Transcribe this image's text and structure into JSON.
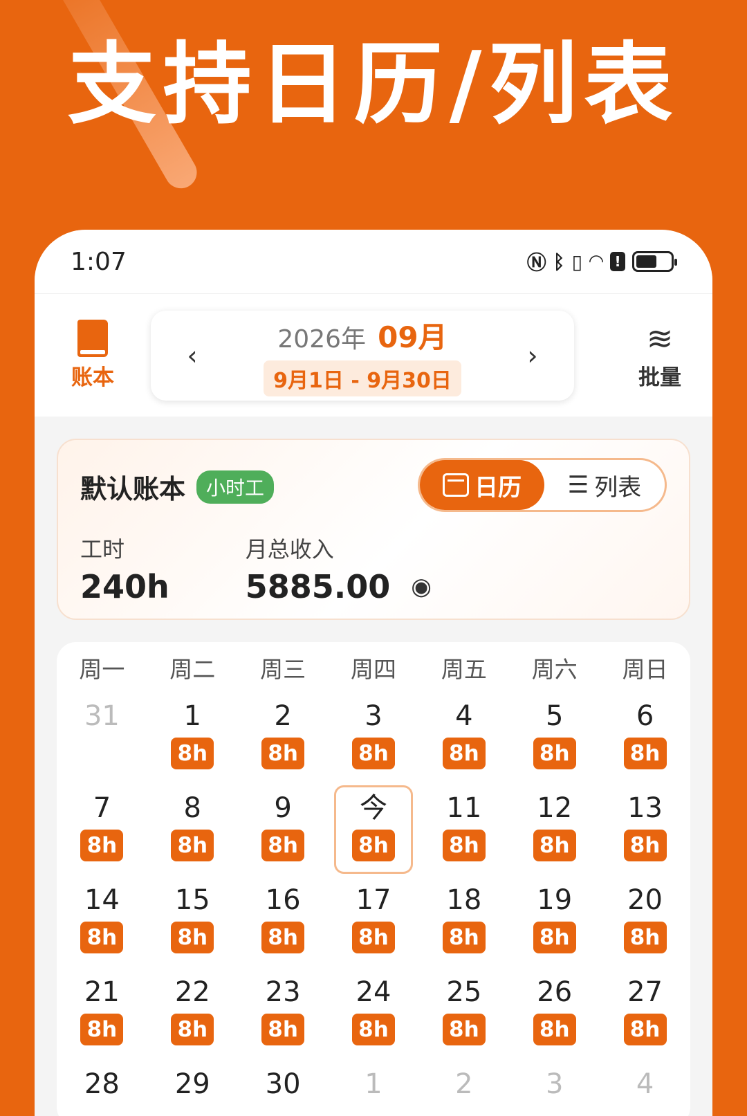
{
  "headline": "支持日历/列表",
  "status_bar": {
    "time": "1:07"
  },
  "header": {
    "ledger_label": "账本",
    "year": "2026年",
    "month": "09月",
    "range": "9月1日 - 9月30日",
    "prev": "‹",
    "next": "›",
    "batch_label": "批量"
  },
  "summary": {
    "book_name": "默认账本",
    "tag": "小时工",
    "toggle": {
      "calendar": "日历",
      "list": "列表",
      "active": "calendar"
    },
    "hours_label": "工时",
    "hours_value": "240h",
    "income_label": "月总收入",
    "income_value": "5885.00"
  },
  "calendar": {
    "weekdays": [
      "周一",
      "周二",
      "周三",
      "周四",
      "周五",
      "周六",
      "周日"
    ],
    "weeks": [
      [
        {
          "d": "31",
          "other": true,
          "h": ""
        },
        {
          "d": "1",
          "h": "8h"
        },
        {
          "d": "2",
          "h": "8h"
        },
        {
          "d": "3",
          "h": "8h"
        },
        {
          "d": "4",
          "h": "8h"
        },
        {
          "d": "5",
          "h": "8h"
        },
        {
          "d": "6",
          "h": "8h"
        }
      ],
      [
        {
          "d": "7",
          "h": "8h"
        },
        {
          "d": "8",
          "h": "8h"
        },
        {
          "d": "9",
          "h": "8h"
        },
        {
          "d": "今",
          "h": "8h",
          "today": true
        },
        {
          "d": "11",
          "h": "8h"
        },
        {
          "d": "12",
          "h": "8h"
        },
        {
          "d": "13",
          "h": "8h"
        }
      ],
      [
        {
          "d": "14",
          "h": "8h"
        },
        {
          "d": "15",
          "h": "8h"
        },
        {
          "d": "16",
          "h": "8h"
        },
        {
          "d": "17",
          "h": "8h"
        },
        {
          "d": "18",
          "h": "8h"
        },
        {
          "d": "19",
          "h": "8h"
        },
        {
          "d": "20",
          "h": "8h"
        }
      ],
      [
        {
          "d": "21",
          "h": "8h"
        },
        {
          "d": "22",
          "h": "8h"
        },
        {
          "d": "23",
          "h": "8h"
        },
        {
          "d": "24",
          "h": "8h"
        },
        {
          "d": "25",
          "h": "8h"
        },
        {
          "d": "26",
          "h": "8h"
        },
        {
          "d": "27",
          "h": "8h"
        }
      ],
      [
        {
          "d": "28",
          "h": ""
        },
        {
          "d": "29",
          "h": ""
        },
        {
          "d": "30",
          "h": ""
        },
        {
          "d": "1",
          "other": true,
          "h": ""
        },
        {
          "d": "2",
          "other": true,
          "h": ""
        },
        {
          "d": "3",
          "other": true,
          "h": ""
        },
        {
          "d": "4",
          "other": true,
          "h": ""
        }
      ]
    ]
  },
  "colors": {
    "accent": "#E8650F",
    "tag_green": "#4FAE5A"
  }
}
